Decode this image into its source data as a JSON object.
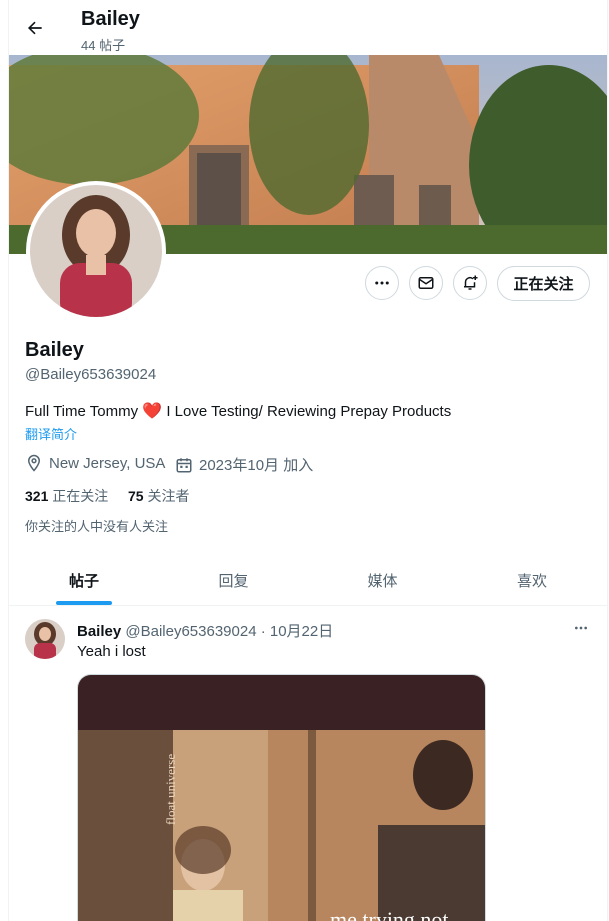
{
  "header": {
    "title": "Bailey",
    "post_count": "44 帖子"
  },
  "profile": {
    "display_name": "Bailey",
    "handle": "@Bailey653639024",
    "bio_before": "Full Time Tommy ",
    "bio_emoji": "❤️",
    "bio_after": " I Love Testing/ Reviewing Prepay Products",
    "translate_label": "翻译简介",
    "location": "New Jersey, USA",
    "joined": "2023年10月 加入",
    "following_count": "321",
    "following_label": "正在关注",
    "followers_count": "75",
    "followers_label": "关注者",
    "mutual_note": "你关注的人中没有人关注",
    "follow_button": "正在关注"
  },
  "tabs": [
    {
      "label": "帖子",
      "active": true
    },
    {
      "label": "回复",
      "active": false
    },
    {
      "label": "媒体",
      "active": false
    },
    {
      "label": "喜欢",
      "active": false
    }
  ],
  "post": {
    "author": "Bailey",
    "meta": "@Bailey653639024 · 10月22日",
    "text": "Yeah i lost",
    "media_caption": "me trying not",
    "media_watermark": "float universe"
  },
  "icons": {
    "back": "arrow-left-icon",
    "more": "more-horizontal-icon",
    "message": "envelope-icon",
    "notify": "bell-plus-icon",
    "location": "location-pin-icon",
    "calendar": "calendar-icon"
  },
  "colors": {
    "accent": "#1d9bf0",
    "text": "#0f1419",
    "muted": "#536471",
    "heart": "#e0245e"
  }
}
